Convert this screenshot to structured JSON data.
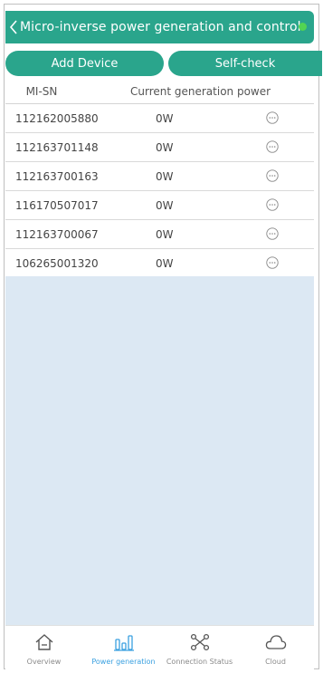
{
  "header": {
    "title": "Micro-inverse power generation and control"
  },
  "actions": {
    "add_device": "Add Device",
    "self_check": "Self-check"
  },
  "table": {
    "columns": [
      "MI-SN",
      "Current generation power"
    ],
    "rows": [
      {
        "sn": "112162005880",
        "power": "0W"
      },
      {
        "sn": "112163701148",
        "power": "0W"
      },
      {
        "sn": "112163700163",
        "power": "0W"
      },
      {
        "sn": "116170507017",
        "power": "0W"
      },
      {
        "sn": "112163700067",
        "power": "0W"
      },
      {
        "sn": "106265001320",
        "power": "0W"
      }
    ]
  },
  "tabs": [
    {
      "label": "Overview",
      "icon": "home-icon"
    },
    {
      "label": "Power generation",
      "icon": "bar-chart-icon"
    },
    {
      "label": "Connection Status",
      "icon": "network-icon"
    },
    {
      "label": "Cloud",
      "icon": "cloud-icon"
    }
  ],
  "colors": {
    "primary": "#2aa58c",
    "active_tab": "#3aa0e0",
    "empty_area": "#dce8f3",
    "status_dot": "#52d452"
  }
}
